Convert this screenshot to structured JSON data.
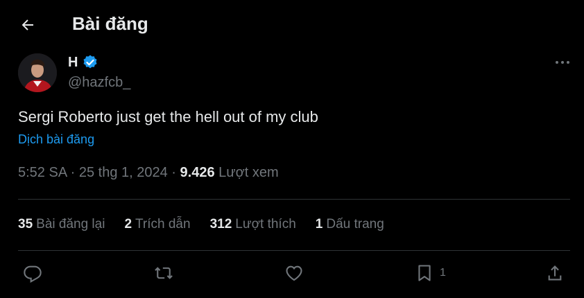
{
  "header": {
    "title": "Bài đăng"
  },
  "author": {
    "name": "H",
    "handle": "@hazfcb_"
  },
  "tweet": {
    "text": "Sergi Roberto just get the hell out of my club",
    "translate_label": "Dịch bài đăng",
    "time": "5:52 SA",
    "date": "25 thg 1, 2024",
    "views_count": "9.426",
    "views_label": "Lượt xem"
  },
  "stats": [
    {
      "count": "35",
      "label": "Bài đăng lại"
    },
    {
      "count": "2",
      "label": "Trích dẫn"
    },
    {
      "count": "312",
      "label": "Lượt thích"
    },
    {
      "count": "1",
      "label": "Dấu trang"
    }
  ],
  "actions": {
    "bookmark_count": "1"
  },
  "colors": {
    "background": "#000000",
    "accent": "#1d9bf0",
    "muted": "#71767b",
    "text": "#e7e9ea"
  },
  "icons": [
    "back-arrow-icon",
    "verified-badge-icon",
    "more-icon",
    "reply-icon",
    "retweet-icon",
    "like-icon",
    "bookmark-icon",
    "share-icon"
  ]
}
